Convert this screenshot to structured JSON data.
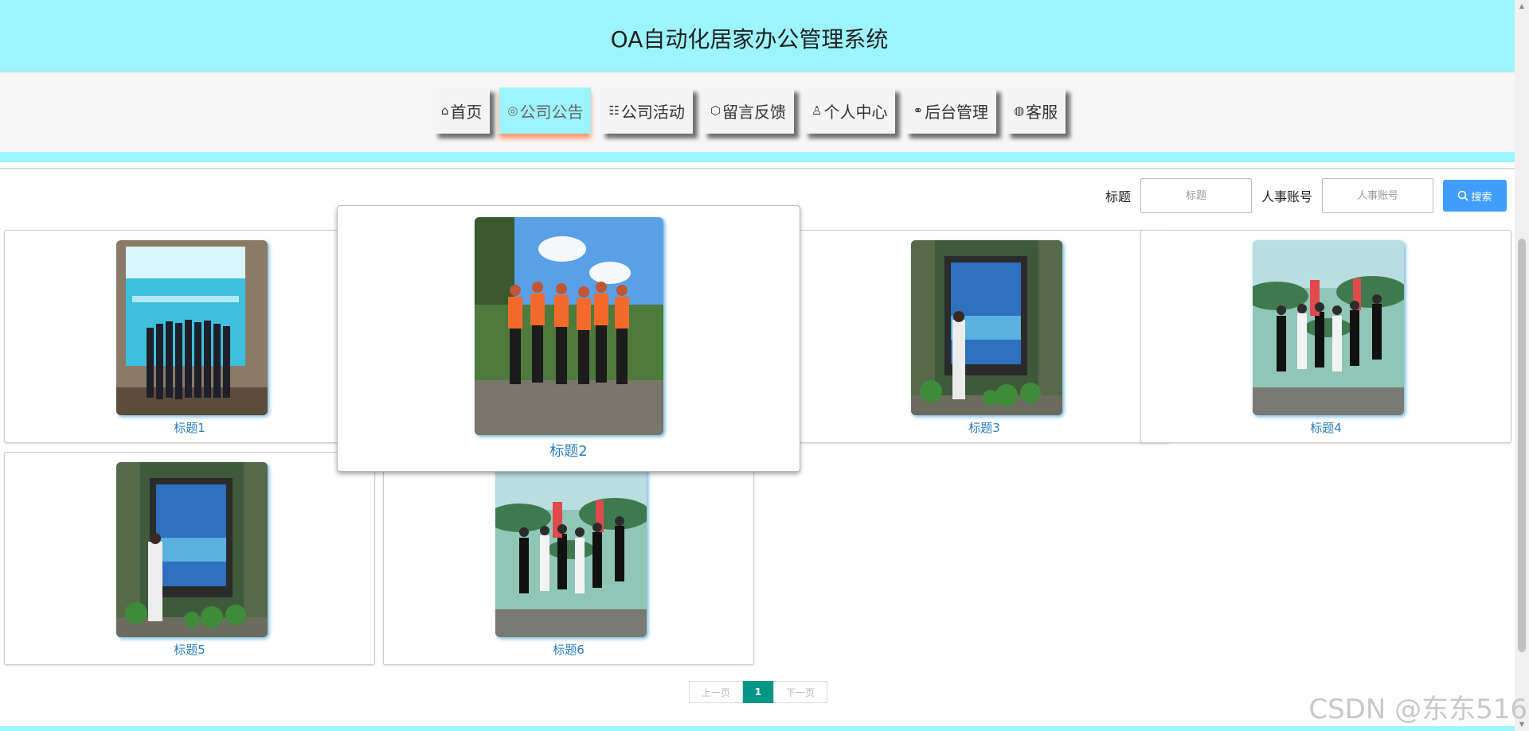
{
  "header": {
    "title": "OA自动化居家办公管理系统"
  },
  "nav": {
    "items": [
      {
        "icon": "⌂",
        "label": "首页"
      },
      {
        "icon": "◎",
        "label": "公司公告"
      },
      {
        "icon": "☷",
        "label": "公司活动"
      },
      {
        "icon": "⬡",
        "label": "留言反馈"
      },
      {
        "icon": "♙",
        "label": "个人中心"
      },
      {
        "icon": "⚭",
        "label": "后台管理"
      },
      {
        "icon": "◍",
        "label": "客服"
      }
    ],
    "active_index": 1
  },
  "search": {
    "title_label": "标题",
    "title_placeholder": "标题",
    "account_label": "人事账号",
    "account_placeholder": "人事账号",
    "button_label": "搜索",
    "button_icon": "search-icon"
  },
  "cards": [
    {
      "title": "标题1"
    },
    {
      "title": "标题2"
    },
    {
      "title": "标题3"
    },
    {
      "title": "标题4"
    },
    {
      "title": "标题5"
    },
    {
      "title": "标题6"
    }
  ],
  "hovered_card_index": 1,
  "pagination": {
    "prev": "上一页",
    "current": "1",
    "next": "下一页"
  },
  "watermark": "CSDN @东东516",
  "colors": {
    "accent": "#9cf5fc",
    "search_button": "#409eff",
    "page_active": "#009688",
    "card_title": "#2b7fc0"
  }
}
